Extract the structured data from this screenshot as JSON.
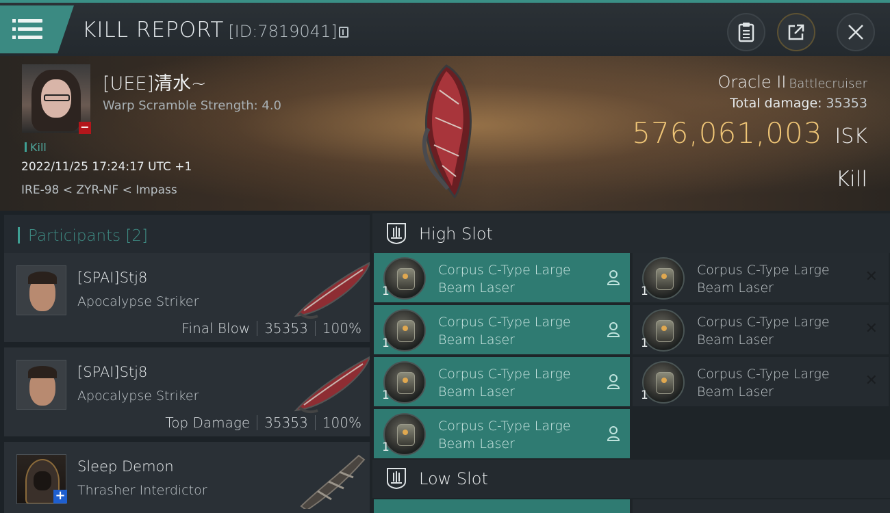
{
  "header": {
    "title": "KILL REPORT",
    "id_text": "[ID:7819041]"
  },
  "victim": {
    "name": "[UEE]清水~",
    "warp_scramble": "Warp Scramble Strength: 4.0",
    "kill_tag": "Kill",
    "timestamp": "2022/11/25 17:24:17 UTC +1",
    "location": "IRE-98 < ZYR-NF < Impass",
    "ship": "Oracle II",
    "ship_class": "Battlecruiser",
    "total_damage_label": "Total damage:",
    "total_damage": "35353",
    "isk_value": "576,061,003",
    "isk_unit": "ISK",
    "result": "Kill"
  },
  "participants": {
    "label": "Participants [2]",
    "items": [
      {
        "name": "[SPAI]Stj8",
        "ship": "Apocalypse Striker",
        "role": "Final Blow",
        "damage": "35353",
        "percent": "100%"
      },
      {
        "name": "[SPAI]Stj8",
        "ship": "Apocalypse Striker",
        "role": "Top Damage",
        "damage": "35353",
        "percent": "100%"
      },
      {
        "name": "Sleep Demon",
        "ship": "Thrasher Interdictor"
      }
    ]
  },
  "fitting": {
    "high_slot_label": "High Slot",
    "low_slot_label": "Low Slot",
    "high_left": [
      {
        "qty": "1",
        "line1": "Corpus C-Type Large",
        "line2": "Beam Laser"
      },
      {
        "qty": "1",
        "line1": "Corpus C-Type Large",
        "line2": "Beam Laser"
      },
      {
        "qty": "1",
        "line1": "Corpus C-Type Large",
        "line2": "Beam Laser"
      },
      {
        "qty": "1",
        "line1": "Corpus C-Type Large",
        "line2": "Beam Laser"
      }
    ],
    "high_right": [
      {
        "qty": "1",
        "line1": "Corpus C-Type Large",
        "line2": "Beam Laser"
      },
      {
        "qty": "1",
        "line1": "Corpus C-Type Large",
        "line2": "Beam Laser"
      },
      {
        "qty": "1",
        "line1": "Corpus C-Type Large",
        "line2": "Beam Laser"
      }
    ]
  },
  "colors": {
    "accent": "#3b8a82",
    "isk": "#f0c677",
    "destroyed_bg": "#2f7b72",
    "dropped_bg": "#252b30"
  },
  "icons": [
    "menu-icon",
    "clipboard-icon",
    "share-icon",
    "close-icon",
    "copy-icon",
    "slot-icon",
    "person-icon",
    "x-icon"
  ]
}
